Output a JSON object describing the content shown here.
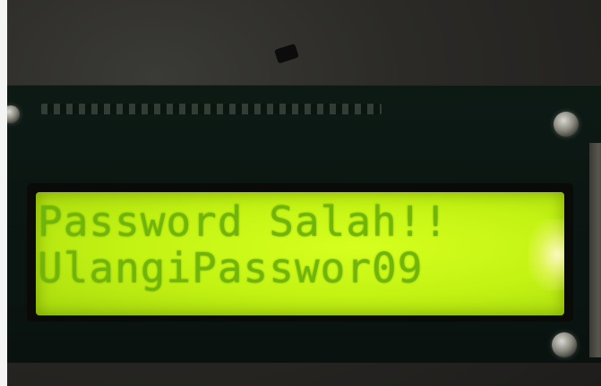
{
  "lcd": {
    "line1": "Password Salah!!",
    "line2": "UlangiPasswor09"
  },
  "colors": {
    "backlight": "#c3f313",
    "text": "#6fb50a",
    "pcb": "#0b1612"
  }
}
